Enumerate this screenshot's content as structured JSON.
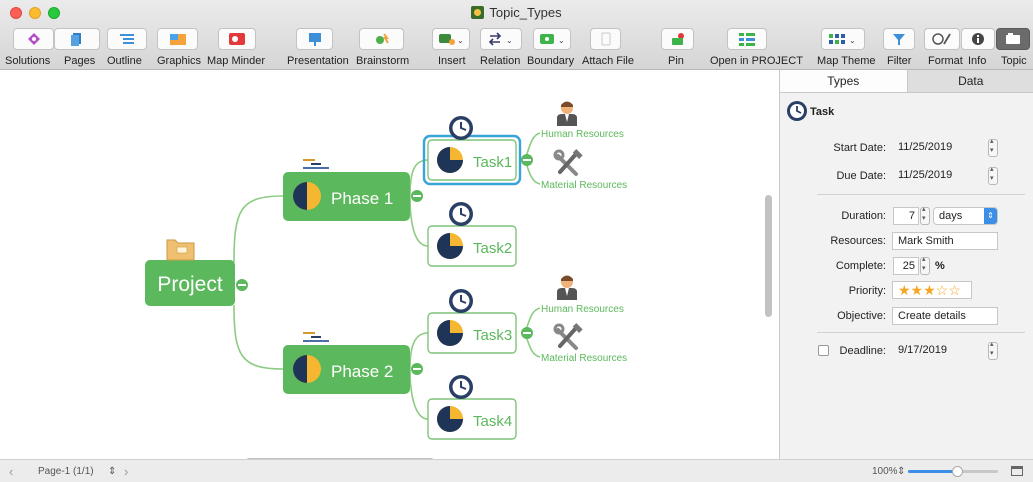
{
  "window": {
    "title": "Topic_Types"
  },
  "toolbar": {
    "items": [
      {
        "label": "Solutions",
        "icon": "solutions-icon"
      },
      {
        "label": "Pages",
        "icon": "pages-icon"
      },
      {
        "label": "Outline",
        "icon": "outline-icon"
      },
      {
        "label": "Graphics",
        "icon": "graphics-icon"
      },
      {
        "label": "Map Minder",
        "icon": "map-minder-icon"
      },
      {
        "label": "Presentation",
        "icon": "presentation-icon"
      },
      {
        "label": "Brainstorm",
        "icon": "brainstorm-icon"
      },
      {
        "label": "Insert",
        "icon": "insert-icon"
      },
      {
        "label": "Relation",
        "icon": "relation-icon"
      },
      {
        "label": "Boundary",
        "icon": "boundary-icon"
      },
      {
        "label": "Attach File",
        "icon": "attach-file-icon"
      },
      {
        "label": "Pin",
        "icon": "pin-icon"
      },
      {
        "label": "Open in PROJECT",
        "icon": "open-in-project-icon"
      },
      {
        "label": "Map Theme",
        "icon": "map-theme-icon"
      },
      {
        "label": "Filter",
        "icon": "filter-icon"
      },
      {
        "label": "Format",
        "icon": "format-icon"
      },
      {
        "label": "Info",
        "icon": "info-icon"
      },
      {
        "label": "Topic",
        "icon": "topic-icon"
      }
    ]
  },
  "map": {
    "root": "Project",
    "phases": [
      "Phase 1",
      "Phase 2"
    ],
    "tasks": [
      "Task1",
      "Task2",
      "Task3",
      "Task4"
    ],
    "resources": {
      "human": "Human Resources",
      "material": "Material Resources"
    }
  },
  "panel": {
    "tabs": [
      "Types",
      "Data"
    ],
    "active_tab": "Types",
    "type_name": "Task",
    "fields": {
      "start_date_label": "Start Date:",
      "start_date": "11/25/2019",
      "due_date_label": "Due Date:",
      "due_date": "11/25/2019",
      "duration_label": "Duration:",
      "duration": "7",
      "duration_unit": "days",
      "resources_label": "Resources:",
      "resources": "Mark Smith",
      "complete_label": "Complete:",
      "complete": "25",
      "complete_unit": "%",
      "priority_label": "Priority:",
      "priority_stars": 3,
      "priority_max": 5,
      "objective_label": "Objective:",
      "objective": "Create details",
      "deadline_label": "Deadline:",
      "deadline": "9/17/2019",
      "deadline_checked": false
    }
  },
  "status": {
    "page": "Page-1 (1/1)",
    "zoom": "100%"
  },
  "colors": {
    "topic_green": "#5cb85c",
    "accent_blue": "#3d9be0",
    "pie_navy": "#1e3557",
    "pie_yellow": "#f5b731"
  }
}
